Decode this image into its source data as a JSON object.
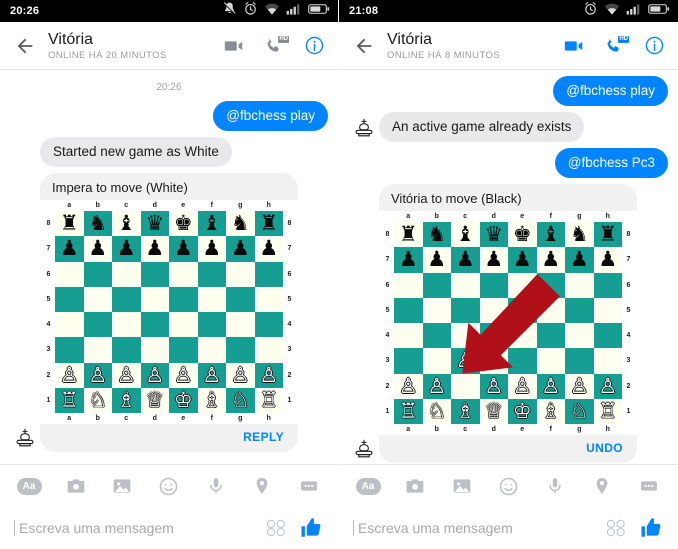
{
  "colors": {
    "accent": "#0084ff",
    "bubble_in": "#e9e9eb",
    "board_dark": "#179e92",
    "board_light": "#fffff0",
    "arrow": "#b01018",
    "icon_gray": "#8a8d91",
    "status_bar": "#000000"
  },
  "panels": [
    {
      "id": "left",
      "status": {
        "time": "20:26",
        "icons": [
          "mute-icon",
          "alarm-icon",
          "wifi-icon",
          "signal-icon",
          "battery-icon"
        ]
      },
      "header": {
        "back": "back-arrow-icon",
        "title": "Vitória",
        "subtitle": "ONLINE HÁ 20 MINUTOS",
        "actions": [
          {
            "name": "video-call-icon",
            "label": "Video call",
            "active": false
          },
          {
            "name": "voice-call-icon",
            "label": "Voice call",
            "badge": "HD",
            "active": false
          },
          {
            "name": "info-icon",
            "label": "Conversation info",
            "active": true
          }
        ]
      },
      "timestamp": "20:26",
      "messages": [
        {
          "dir": "out",
          "text": "@fbchess play"
        },
        {
          "dir": "in",
          "text": "Started new game as White"
        }
      ],
      "card": {
        "header": "Impera to move (White)",
        "action": "REPLY",
        "avatar": "chess-king-avatar",
        "arrow": false
      },
      "composer": {
        "tools": [
          "Aa",
          "camera-icon",
          "gallery-icon",
          "emoji-icon",
          "microphone-icon",
          "location-icon",
          "more-icon"
        ],
        "aa_label": "Aa",
        "placeholder": "Escreva uma mensagem",
        "value": "",
        "sticker": "sticker-icon",
        "like": "thumbs-up-icon"
      }
    },
    {
      "id": "right",
      "status": {
        "time": "21:08",
        "icons": [
          "alarm-icon",
          "wifi-icon",
          "signal-icon",
          "battery-icon"
        ]
      },
      "header": {
        "back": "back-arrow-icon",
        "title": "Vitória",
        "subtitle": "ONLINE HÁ 8 MINUTOS",
        "actions": [
          {
            "name": "video-call-icon",
            "label": "Video call",
            "active": true
          },
          {
            "name": "voice-call-icon",
            "label": "Voice call",
            "badge": "HD",
            "active": true
          },
          {
            "name": "info-icon",
            "label": "Conversation info",
            "active": true
          }
        ]
      },
      "timestamp": "",
      "messages": [
        {
          "dir": "out",
          "text": "@fbchess play"
        },
        {
          "dir": "in",
          "text": "An active game already exists",
          "avatar": "chess-king-avatar"
        },
        {
          "dir": "out",
          "text": "@fbchess Pc3"
        }
      ],
      "card": {
        "header": "Vitória to move (Black)",
        "action": "UNDO",
        "avatar": "chess-king-avatar",
        "arrow": true,
        "arrow_target": "c3"
      },
      "composer": {
        "tools": [
          "Aa",
          "camera-icon",
          "gallery-icon",
          "emoji-icon",
          "microphone-icon",
          "location-icon",
          "more-icon"
        ],
        "aa_label": "Aa",
        "placeholder": "Escreva uma mensagem",
        "value": "",
        "sticker": "sticker-icon",
        "like": "thumbs-up-icon"
      }
    }
  ],
  "board_files": [
    "a",
    "b",
    "c",
    "d",
    "e",
    "f",
    "g",
    "h"
  ],
  "board_ranks": [
    "8",
    "7",
    "6",
    "5",
    "4",
    "3",
    "2",
    "1"
  ],
  "boards": {
    "left": {
      "position": [
        [
          "br",
          "bn",
          "bb",
          "bq",
          "bk",
          "bb",
          "bn",
          "br"
        ],
        [
          "bp",
          "bp",
          "bp",
          "bp",
          "bp",
          "bp",
          "bp",
          "bp"
        ],
        [
          "",
          "",
          "",
          "",
          "",
          "",
          "",
          ""
        ],
        [
          "",
          "",
          "",
          "",
          "",
          "",
          "",
          ""
        ],
        [
          "",
          "",
          "",
          "",
          "",
          "",
          "",
          ""
        ],
        [
          "",
          "",
          "",
          "",
          "",
          "",
          "",
          ""
        ],
        [
          "wp",
          "wp",
          "wp",
          "wp",
          "wp",
          "wp",
          "wp",
          "wp"
        ],
        [
          "wr",
          "wn",
          "wb",
          "wq",
          "wk",
          "wb",
          "wn",
          "wr"
        ]
      ]
    },
    "right": {
      "position": [
        [
          "br",
          "bn",
          "bb",
          "bq",
          "bk",
          "bb",
          "bn",
          "br"
        ],
        [
          "bp",
          "bp",
          "bp",
          "bp",
          "bp",
          "bp",
          "bp",
          "bp"
        ],
        [
          "",
          "",
          "",
          "",
          "",
          "",
          "",
          ""
        ],
        [
          "",
          "",
          "",
          "",
          "",
          "",
          "",
          ""
        ],
        [
          "",
          "",
          "",
          "",
          "",
          "",
          "",
          ""
        ],
        [
          "",
          "",
          "wp",
          "",
          "",
          "",
          "",
          ""
        ],
        [
          "wp",
          "wp",
          "",
          "wp",
          "wp",
          "wp",
          "wp",
          "wp"
        ],
        [
          "wr",
          "wn",
          "wb",
          "wq",
          "wk",
          "wb",
          "wn",
          "wr"
        ]
      ]
    }
  },
  "piece_glyphs": {
    "wk": "♔",
    "wq": "♕",
    "wr": "♖",
    "wb": "♗",
    "wn": "♘",
    "wp": "♙",
    "bk": "♚",
    "bq": "♛",
    "br": "♜",
    "bb": "♝",
    "bn": "♞",
    "bp": "♟"
  }
}
